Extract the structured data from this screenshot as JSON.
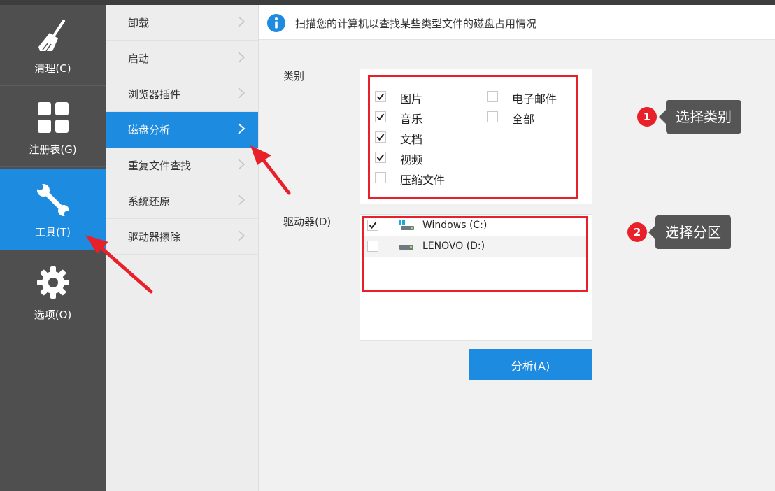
{
  "sidebar": {
    "items": [
      {
        "label": "清理(C)",
        "icon": "broom-icon",
        "active": false
      },
      {
        "label": "注册表(G)",
        "icon": "grid-icon",
        "active": false
      },
      {
        "label": "工具(T)",
        "icon": "wrench-icon",
        "active": true
      },
      {
        "label": "选项(O)",
        "icon": "gear-icon",
        "active": false
      }
    ]
  },
  "menu": {
    "items": [
      {
        "label": "卸载",
        "active": false
      },
      {
        "label": "启动",
        "active": false
      },
      {
        "label": "浏览器插件",
        "active": false
      },
      {
        "label": "磁盘分析",
        "active": true
      },
      {
        "label": "重复文件查找",
        "active": false
      },
      {
        "label": "系统还原",
        "active": false
      },
      {
        "label": "驱动器擦除",
        "active": false
      }
    ]
  },
  "info": {
    "icon": "info-icon",
    "text": "扫描您的计算机以查找某些类型文件的磁盘占用情况"
  },
  "categories": {
    "label": "类别",
    "items": [
      {
        "label": "图片",
        "checked": true
      },
      {
        "label": "音乐",
        "checked": true
      },
      {
        "label": "文档",
        "checked": true
      },
      {
        "label": "视频",
        "checked": true
      },
      {
        "label": "压缩文件",
        "checked": false
      },
      {
        "label": "电子邮件",
        "checked": false
      },
      {
        "label": "全部",
        "checked": false
      }
    ]
  },
  "drives": {
    "label": "驱动器(D)",
    "items": [
      {
        "label": "Windows (C:)",
        "checked": true,
        "icon": "windows-drive-icon"
      },
      {
        "label": "LENOVO (D:)",
        "checked": false,
        "icon": "drive-icon"
      }
    ]
  },
  "analyze_button": "分析(A)",
  "callouts": [
    {
      "number": "1",
      "text": "选择类别"
    },
    {
      "number": "2",
      "text": "选择分区"
    }
  ],
  "colors": {
    "accent": "#1d8be0",
    "sidebar_bg": "#4f4f4f",
    "highlight_red": "#e8202a",
    "callout_bg": "#555555"
  }
}
